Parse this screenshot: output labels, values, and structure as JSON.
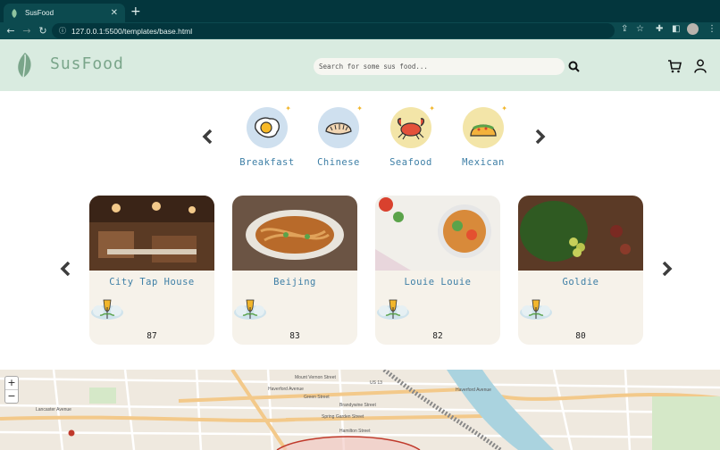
{
  "browser": {
    "tab_title": "SusFood",
    "url": "127.0.0.1:5500/templates/base.html"
  },
  "header": {
    "logo_text": "SusFood",
    "search_placeholder": "Search for some sus food..."
  },
  "categories": [
    {
      "label": "Breakfast",
      "icon": "fried-egg-icon"
    },
    {
      "label": "Chinese",
      "icon": "dumpling-icon"
    },
    {
      "label": "Seafood",
      "icon": "crab-icon"
    },
    {
      "label": "Mexican",
      "icon": "taco-icon"
    }
  ],
  "restaurants": [
    {
      "name": "City Tap House",
      "score": "87"
    },
    {
      "name": "Beijing",
      "score": "83"
    },
    {
      "name": "Louie Louie",
      "score": "82"
    },
    {
      "name": "Goldie",
      "score": "80"
    }
  ],
  "map": {
    "zoom_in": "+",
    "zoom_out": "−",
    "labels": [
      "Haverford Avenue",
      "Spring Garden Street",
      "Brandywine Street",
      "Mount Vernon Street",
      "Green Street",
      "Hamilton Street",
      "US 13",
      "Lancaster Avenue",
      "Haverford Avenue"
    ]
  },
  "colors": {
    "header_bg": "#d9ebe0",
    "logo": "#7aa58a",
    "label_blue": "#3e7fa6",
    "card_bg": "#f6f2ea",
    "browser_dark": "#03363d"
  }
}
